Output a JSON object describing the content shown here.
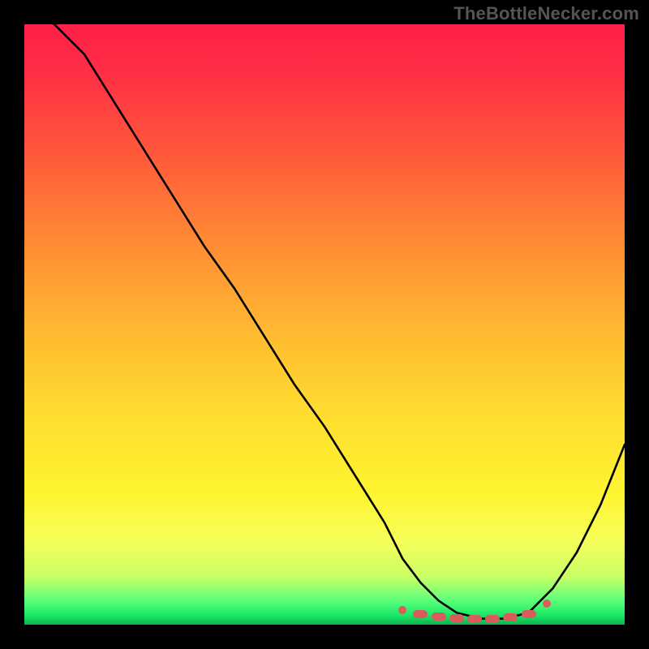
{
  "watermark": "TheBottleNecker.com",
  "chart_data": {
    "type": "line",
    "title": "",
    "xlabel": "",
    "ylabel": "",
    "xlim": [
      0,
      100
    ],
    "ylim": [
      0,
      100
    ],
    "notes": "Gradient background: red (top / high bottleneck) → green (bottom / low bottleneck). Black curve shows bottleneck percentage vs. an x-axis variable; minimum around x≈77.",
    "series": [
      {
        "name": "bottleneck-curve",
        "color": "#000000",
        "x": [
          5,
          10,
          15,
          20,
          25,
          30,
          35,
          40,
          45,
          50,
          55,
          60,
          63,
          66,
          69,
          72,
          76,
          80,
          84,
          88,
          92,
          96,
          100
        ],
        "y": [
          100,
          95,
          87,
          79,
          71,
          63,
          56,
          48,
          40,
          33,
          25,
          17,
          11,
          7,
          4,
          2,
          1,
          1,
          2,
          6,
          12,
          20,
          30
        ]
      }
    ],
    "markers": {
      "name": "optimal-zone-dots",
      "color": "#d95b5b",
      "points": [
        {
          "x": 63,
          "y": 2.5,
          "shape": "round"
        },
        {
          "x": 66,
          "y": 1.8,
          "shape": "pill"
        },
        {
          "x": 69,
          "y": 1.4,
          "shape": "pill"
        },
        {
          "x": 72,
          "y": 1.1,
          "shape": "pill"
        },
        {
          "x": 75,
          "y": 1.0,
          "shape": "pill"
        },
        {
          "x": 78,
          "y": 1.0,
          "shape": "pill"
        },
        {
          "x": 81,
          "y": 1.2,
          "shape": "pill"
        },
        {
          "x": 84,
          "y": 1.8,
          "shape": "pill"
        },
        {
          "x": 87,
          "y": 3.5,
          "shape": "round"
        }
      ]
    }
  }
}
